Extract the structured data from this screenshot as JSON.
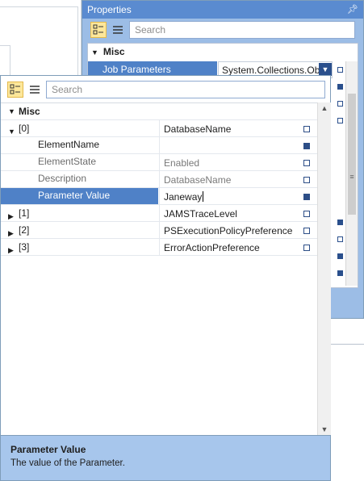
{
  "properties_panel": {
    "title": "Properties",
    "pin_icon": "pin-icon",
    "search_placeholder": "Search",
    "category": "Misc",
    "job_parameters": {
      "label": "Job Parameters",
      "value": "System.Collections.Obje"
    }
  },
  "popup": {
    "search_placeholder": "Search",
    "category": "Misc",
    "rows": [
      {
        "label": "[0]",
        "value": "DatabaseName"
      },
      {
        "label": "ElementName",
        "value": ""
      },
      {
        "label": "ElementState",
        "value": "Enabled"
      },
      {
        "label": "Description",
        "value": "DatabaseName"
      },
      {
        "label": "Parameter Value",
        "value": "Janeway"
      },
      {
        "label": "[1]",
        "value": "JAMSTraceLevel"
      },
      {
        "label": "[2]",
        "value": "PSExecutionPolicyPreference"
      },
      {
        "label": "[3]",
        "value": "ErrorActionPreference"
      }
    ],
    "description": {
      "title": "Parameter Value",
      "text": "The value of the Parameter."
    }
  },
  "colors": {
    "panel_title": "#5a8bd0",
    "panel_background": "#9cbde6",
    "selection": "#4f81c7",
    "description_background": "#a7c6ec",
    "active_toggle": "#fde79a"
  }
}
